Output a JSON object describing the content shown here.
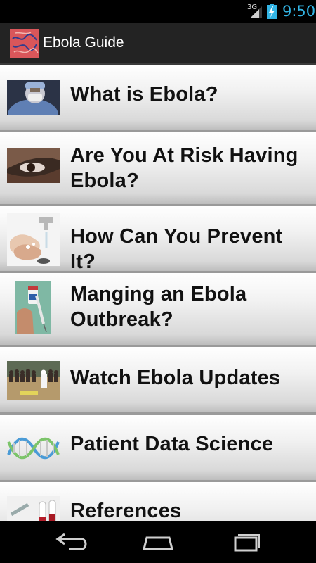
{
  "status_bar": {
    "network_type": "3G",
    "time": "9:50",
    "icons": [
      "signal-icon",
      "battery-charging-icon"
    ]
  },
  "action_bar": {
    "title": "Ebola Guide",
    "icon": "ebola-guide-app-icon"
  },
  "menu": {
    "items": [
      {
        "label": "What is Ebola?",
        "thumb": "health-worker-in-protective-gear"
      },
      {
        "label": "Are You At Risk Having Ebola?",
        "thumb": "sick-person-eye"
      },
      {
        "label": "How Can You Prevent It?",
        "thumb": "hand-washing"
      },
      {
        "label": "Manging an Ebola Outbreak?",
        "thumb": "vaccine-vial-and-syringe"
      },
      {
        "label": "Watch Ebola Updates",
        "thumb": "crowd-and-responders"
      },
      {
        "label": "Patient Data Science",
        "thumb": "dna-helix"
      },
      {
        "label": "References",
        "thumb": "lab-test-tubes"
      }
    ]
  },
  "nav_bar": {
    "buttons": [
      "back-icon",
      "home-icon",
      "recent-apps-icon"
    ]
  },
  "colors": {
    "status_accent": "#33b5e5",
    "action_bar_bg": "#232323",
    "list_text": "#111111"
  }
}
